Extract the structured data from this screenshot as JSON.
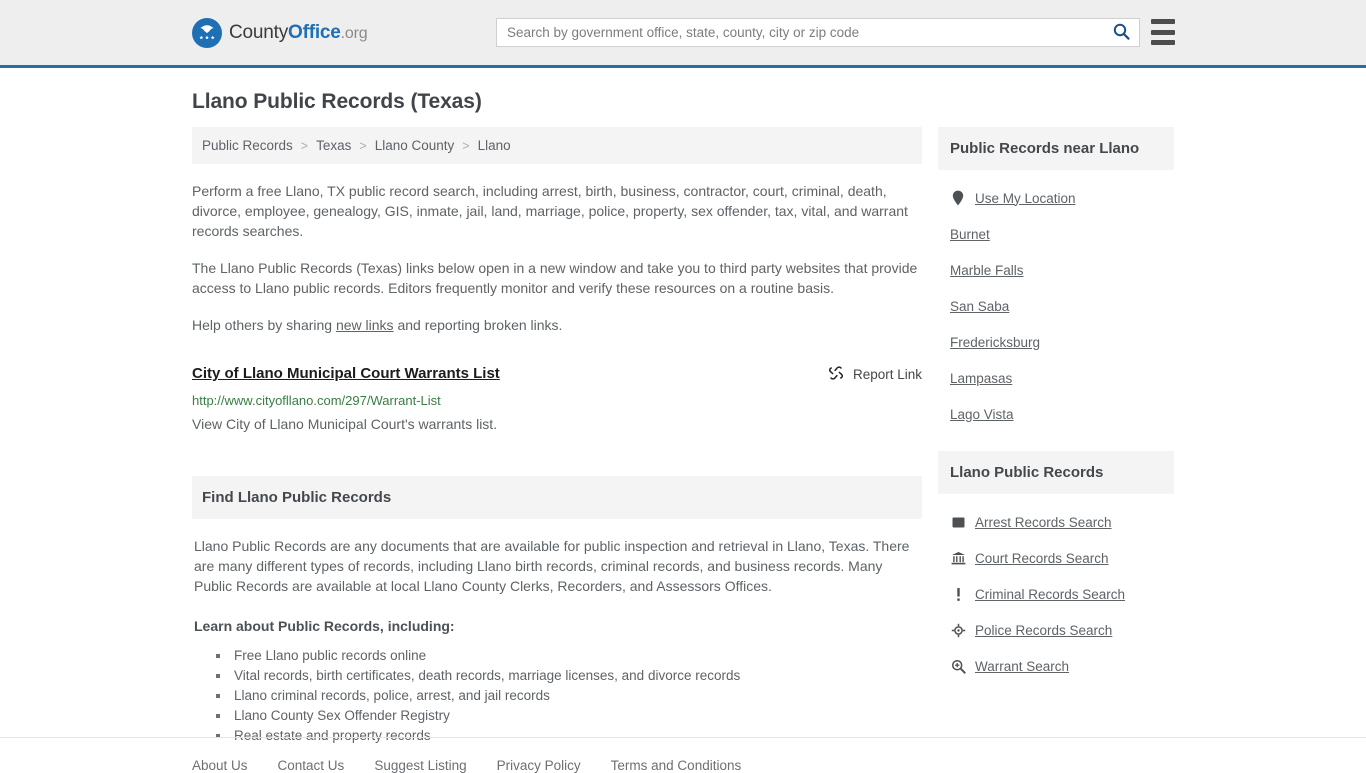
{
  "header": {
    "logo": {
      "icon": "eagle-shield-icon",
      "text_county": "County",
      "text_office": "Office",
      "text_tld": ".org"
    },
    "search": {
      "placeholder": "Search by government office, state, county, city or zip code",
      "value": "",
      "icon": "search-icon"
    },
    "menu_icon": "hamburger-menu-icon",
    "accent_color": "#2a6aa5"
  },
  "page_title": "Llano Public Records (Texas)",
  "breadcrumb": {
    "separator": ">",
    "items": [
      {
        "label": "Public Records",
        "current": false
      },
      {
        "label": "Texas",
        "current": false
      },
      {
        "label": "Llano County",
        "current": false
      },
      {
        "label": "Llano",
        "current": true
      }
    ]
  },
  "intro": {
    "paragraph_1": "Perform a free Llano, TX public record search, including arrest, birth, business, contractor, court, criminal, death, divorce, employee, genealogy, GIS, inmate, jail, land, marriage, police, property, sex offender, tax, vital, and warrant records searches.",
    "paragraph_2": "The Llano Public Records (Texas) links below open in a new window and take you to third party websites that provide access to Llano public records. Editors frequently monitor and verify these resources on a routine basis.",
    "paragraph_3_before": "Help others by sharing ",
    "paragraph_3_link": "new links",
    "paragraph_3_after": " and reporting broken links."
  },
  "link_entry": {
    "title": "City of Llano Municipal Court Warrants List",
    "url": "http://www.cityofllano.com/297/Warrant-List",
    "description": "View City of Llano Municipal Court's warrants list.",
    "report_label": "Report Link",
    "report_icon": "broken-link-icon",
    "url_color": "#3a7d43"
  },
  "find_section": {
    "heading": "Find Llano Public Records",
    "paragraph": "Llano Public Records are any documents that are available for public inspection and retrieval in Llano, Texas. There are many different types of records, including Llano birth records, criminal records, and business records. Many Public Records are available at local Llano County Clerks, Recorders, and Assessors Offices.",
    "learn_label": "Learn about Public Records, including:",
    "bullets": [
      "Free Llano public records online",
      "Vital records, birth certificates, death records, marriage licenses, and divorce records",
      "Llano criminal records, police, arrest, and jail records",
      "Llano County Sex Offender Registry",
      "Real estate and property records"
    ]
  },
  "sidebar": {
    "near_card": {
      "heading": "Public Records near Llano",
      "items": [
        {
          "label": "Use My Location",
          "icon": "map-pin-icon"
        },
        {
          "label": "Burnet",
          "icon": ""
        },
        {
          "label": "Marble Falls",
          "icon": ""
        },
        {
          "label": "San Saba",
          "icon": ""
        },
        {
          "label": "Fredericksburg",
          "icon": ""
        },
        {
          "label": "Lampasas",
          "icon": ""
        },
        {
          "label": "Lago Vista",
          "icon": ""
        }
      ]
    },
    "records_card": {
      "heading": "Llano Public Records",
      "items": [
        {
          "label": "Arrest Records Search",
          "icon": "fingerprint-square-icon"
        },
        {
          "label": "Court Records Search",
          "icon": "courthouse-bank-icon"
        },
        {
          "label": "Criminal Records Search",
          "icon": "exclamation-mark-icon"
        },
        {
          "label": "Police Records Search",
          "icon": "police-badge-icon"
        },
        {
          "label": "Warrant Search",
          "icon": "magnifier-plus-icon"
        }
      ]
    }
  },
  "footer": {
    "links": [
      "About Us",
      "Contact Us",
      "Suggest Listing",
      "Privacy Policy",
      "Terms and Conditions"
    ]
  }
}
